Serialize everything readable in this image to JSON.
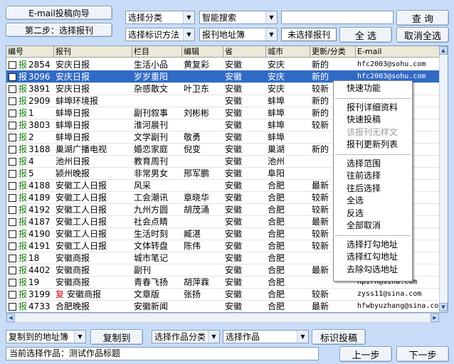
{
  "wizard": {
    "title": "E-mail投稿向导",
    "step": "第二步：选择报刊"
  },
  "toolbar": {
    "category_combo": "选择分类",
    "search_mode_combo": "智能搜索",
    "search_value": "",
    "search_button": "查 询",
    "mark_method_combo": "选择标识方法",
    "addressbook_combo": "报刊地址簿",
    "unselected_label": "未选择报刊",
    "select_all_button": "全 选",
    "cancel_all_button": "取消全选"
  },
  "grid": {
    "headers": [
      "编号",
      "报刊",
      "栏目",
      "编辑",
      "省",
      "城市",
      "更新/分类",
      "E-mail"
    ],
    "rows": [
      {
        "mark": "报",
        "markColor": "green",
        "id": "2854",
        "paper": "安庆日报",
        "column": "生活小品",
        "editor": "黄复彩",
        "province": "安徽",
        "city": "安庆",
        "update": "新的",
        "email": "hfc2003@sohu.com",
        "selected": false
      },
      {
        "mark": "报",
        "markColor": "green",
        "id": "3096",
        "paper": "安庆日报",
        "column": "岁岁重阳",
        "editor": "",
        "province": "安徽",
        "city": "安庆",
        "update": "新的",
        "email": "hfc2003@sohu.com",
        "selected": true
      },
      {
        "mark": "报",
        "markColor": "green",
        "id": "3891",
        "paper": "安庆日报",
        "column": "杂感散文",
        "editor": "叶卫东",
        "province": "安徽",
        "city": "安庆",
        "update": "较新",
        "email": "",
        "selected": false
      },
      {
        "mark": "报",
        "markColor": "green",
        "id": "2909",
        "paper": "蚌埠环境报",
        "column": "",
        "editor": "",
        "province": "安徽",
        "city": "蚌埠",
        "update": "新的",
        "email": "v.cn",
        "selected": false
      },
      {
        "mark": "报",
        "markColor": "green",
        "id": "1",
        "paper": "蚌埠日报",
        "column": "副刊叙事",
        "editor": "刘彬彬",
        "province": "安徽",
        "city": "蚌埠",
        "update": "新的",
        "email": "",
        "selected": false
      },
      {
        "mark": "报",
        "markColor": "green",
        "id": "3803",
        "paper": "蚌埠日报",
        "column": "淮河晨刊",
        "editor": "",
        "province": "安徽",
        "city": "蚌埠",
        "update": "较新",
        "email": "m",
        "selected": false
      },
      {
        "mark": "报",
        "markColor": "green",
        "id": "2",
        "paper": "蚌埠日报",
        "column": "文学副刊",
        "editor": "敬勇",
        "province": "安徽",
        "city": "蚌埠",
        "update": "",
        "email": "m",
        "selected": false
      },
      {
        "mark": "报",
        "markColor": "green",
        "id": "3188",
        "paper": "巢湖广播电视",
        "column": "婚恋家庭",
        "editor": "倪变",
        "province": "安徽",
        "city": "巢湖",
        "update": "新的",
        "email": "na.co",
        "selected": false
      },
      {
        "mark": "报",
        "markColor": "green",
        "id": "4",
        "paper": "池州日报",
        "column": "教育周刊",
        "editor": "",
        "province": "安徽",
        "city": "池州",
        "update": "",
        "email": "om",
        "selected": false
      },
      {
        "mark": "报",
        "markColor": "green",
        "id": "5",
        "paper": "颍州晚报",
        "column": "非常男女",
        "editor": "邢军鹏",
        "province": "安徽",
        "city": "阜阳",
        "update": "",
        "email": "com",
        "selected": false
      },
      {
        "mark": "报",
        "markColor": "green",
        "id": "4188",
        "paper": "安徽工人日报",
        "column": "风采",
        "editor": "",
        "province": "安徽",
        "city": "合肥",
        "update": "最新",
        "email": "163.",
        "selected": false
      },
      {
        "mark": "报",
        "markColor": "green",
        "id": "4189",
        "paper": "安徽工人日报",
        "column": "工会潮讯",
        "editor": "章晓华",
        "province": "安徽",
        "city": "合肥",
        "update": "较新",
        "email": "4416",
        "selected": false
      },
      {
        "mark": "报",
        "markColor": "green",
        "id": "4192",
        "paper": "安徽工人日报",
        "column": "九州方圆",
        "editor": "胡茂涌",
        "province": "安徽",
        "city": "合肥",
        "update": "较新",
        "email": "@163.",
        "selected": false
      },
      {
        "mark": "报",
        "markColor": "green",
        "id": "4187",
        "paper": "安徽工人日报",
        "column": "社会点睛",
        "editor": "",
        "province": "安徽",
        "city": "合肥",
        "update": "最新",
        "email": "om",
        "selected": false
      },
      {
        "mark": "报",
        "markColor": "green",
        "id": "4190",
        "paper": "安徽工人日报",
        "column": "生活时刻",
        "editor": "臧湛",
        "province": "安徽",
        "city": "合肥",
        "update": "较新",
        "email": "63.co",
        "selected": false
      },
      {
        "mark": "报",
        "markColor": "green",
        "id": "4191",
        "paper": "安徽工人日报",
        "column": "文体转盘",
        "editor": "陈伟",
        "province": "安徽",
        "city": "合肥",
        "update": "较新",
        "email": "om",
        "selected": false
      },
      {
        "mark": "报",
        "markColor": "green",
        "id": "18",
        "paper": "安徽商报",
        "column": "城市笔记",
        "editor": "",
        "province": "安徽",
        "city": "合肥",
        "update": "",
        "email": "com",
        "selected": false
      },
      {
        "mark": "报",
        "markColor": "green",
        "id": "4402",
        "paper": "安徽商报",
        "column": "副刊",
        "editor": "",
        "province": "安徽",
        "city": "合肥",
        "update": "最新",
        "email": "com",
        "selected": false
      },
      {
        "mark": "报",
        "markColor": "green",
        "id": "19",
        "paper": "安徽商报",
        "column": "青春飞扬",
        "editor": "胡萍霖",
        "province": "安徽",
        "city": "合肥",
        "update": "",
        "email": "hpirn@sina.com",
        "selected": false
      },
      {
        "mark": "报",
        "markColor": "green",
        "id": "3199",
        "paper": "安徽商报",
        "paperMark": "复",
        "column": "文章版",
        "editor": "张扬",
        "province": "安徽",
        "city": "合肥",
        "update": "较新",
        "email": "zyss11@sina.com",
        "selected": false
      },
      {
        "mark": "报",
        "markColor": "green",
        "id": "4733",
        "paper": "合肥晚报",
        "column": "安徽新闻",
        "editor": "",
        "province": "安徽",
        "city": "合肥",
        "update": "最新",
        "email": "hfwbyuzhang@sina.co",
        "selected": false
      }
    ]
  },
  "context_menu": {
    "items": [
      {
        "label": "快速功能",
        "disabled": false
      },
      {
        "sep": true
      },
      {
        "label": "报刊详细资料",
        "disabled": false
      },
      {
        "label": "快速投稿",
        "disabled": false
      },
      {
        "label": "该报刊无样文",
        "disabled": true
      },
      {
        "label": "报刊更新列表",
        "disabled": false
      },
      {
        "sep": true
      },
      {
        "label": "选择范围",
        "disabled": false
      },
      {
        "label": "往前选择",
        "disabled": false
      },
      {
        "label": "往后选择",
        "disabled": false
      },
      {
        "label": "全选",
        "disabled": false
      },
      {
        "label": "反选",
        "disabled": false
      },
      {
        "label": "全部取消",
        "disabled": false
      },
      {
        "sep": true
      },
      {
        "label": "选择打勾地址",
        "disabled": false
      },
      {
        "label": "选择红勾地址",
        "disabled": false
      },
      {
        "label": "去除勾选地址",
        "disabled": false
      }
    ]
  },
  "bottom": {
    "copy_target_combo": "复制到的地址簿",
    "copy_button": "复制到",
    "work_category_combo": "选择作品分类",
    "work_combo": "选择作品",
    "mark_submit_button": "标识投稿",
    "status_text": "当前选择作品：测试作品标题",
    "prev_button": "上一步",
    "next_button": "下一步"
  },
  "colors": {
    "background": "#c9dcf7",
    "selection": "#316ac5",
    "mark_green": "#1b7d14",
    "mark_red": "#c01010"
  }
}
